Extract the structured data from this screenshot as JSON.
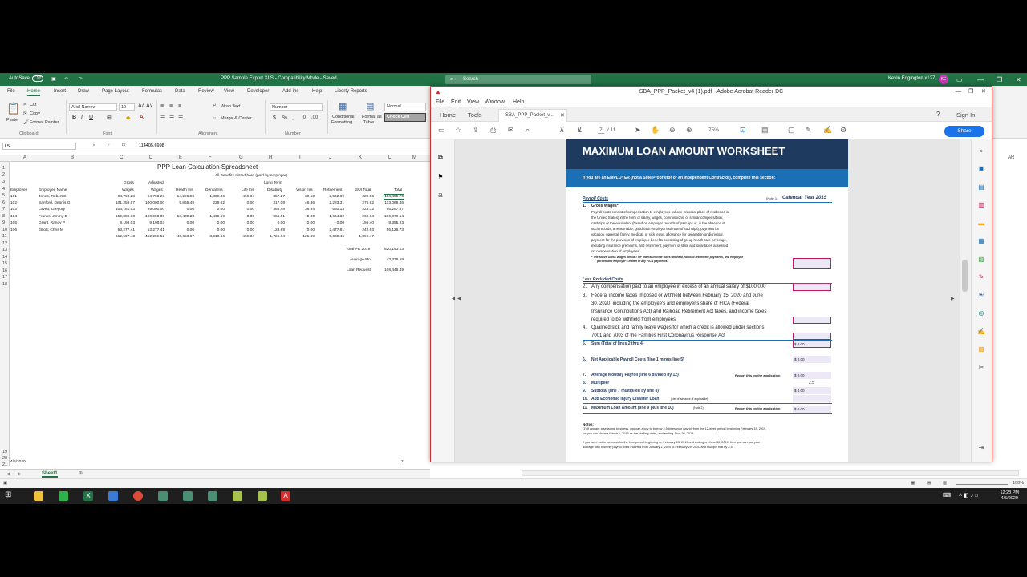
{
  "excel": {
    "autosave": "AutoSave",
    "autosave_state": "Off",
    "title": "PPP Sample Export.XLS  -  Compatibility Mode  -  Saved",
    "search_placeholder": "Search",
    "user": "Kevin Edgington x127",
    "avatar": "KE",
    "tabs": [
      "File",
      "Home",
      "Insert",
      "Draw",
      "Page Layout",
      "Formulas",
      "Data",
      "Review",
      "View",
      "Developer",
      "Add-ins",
      "Help",
      "Liberty Reports"
    ],
    "ribbon": {
      "paste": "Paste",
      "cut": "Cut",
      "copy": "Copy",
      "format_painter": "Format Painter",
      "clipboard": "Clipboard",
      "font_name": "Arial Narrow",
      "font_size": "10",
      "font": "Font",
      "wrap_text": "Wrap Text",
      "merge_center": "Merge & Center",
      "alignment": "Alignment",
      "number_format": "Number",
      "number": "Number",
      "conditional": "Conditional",
      "formatting": "Formatting",
      "format_as": "Format as",
      "table": "Table",
      "style_normal": "Normal",
      "style_check": "Check Cell"
    },
    "name_box": "L5",
    "formula": "114405.6998",
    "columns": [
      "A",
      "B",
      "C",
      "D",
      "E",
      "F",
      "G",
      "H",
      "I",
      "J",
      "K",
      "L",
      "M"
    ],
    "rows": [
      "1",
      "2",
      "3",
      "4",
      "5",
      "6",
      "7",
      "8",
      "9",
      "10",
      "11",
      "12",
      "13",
      "14",
      "15",
      "16",
      "17",
      "18",
      "19",
      "20",
      "21"
    ],
    "sheet": {
      "title": "PPP Loan Calculation Spreadsheet",
      "subtitle": "All Benefits Listed here (paid by employer)",
      "hdr_top": {
        "gross": "Gross",
        "adjusted": "Adjusted",
        "long_term": "Long Term"
      },
      "headers": [
        "Employee",
        "Employee Name",
        "Wages",
        "Wages",
        "Health Ins",
        "Dental Ins",
        "Life Ins",
        "Disability",
        "Vision Ins",
        "Retirement",
        "SUI Total",
        "Total"
      ],
      "data": [
        [
          "101",
          "Jones, Robert E",
          "94,793.28",
          "94,793.28",
          "14,295.90",
          "1,309.36",
          "469.34",
          "357.27",
          "38.10",
          "2,562.89",
          "229.66",
          "114,405.70"
        ],
        [
          "102",
          "Sanford, Dennis G",
          "101,259.67",
          "100,000.00",
          "9,865.49",
          "239.62",
          "0.00",
          "317.09",
          "46.86",
          "2,283.31",
          "276.62",
          "113,068.46"
        ],
        [
          "103",
          "Lovett, Gregory",
          "103,181.53",
          "95,000.00",
          "0.00",
          "0.00",
          "0.00",
          "365.48",
          "36.94",
          "660.13",
          "225.32",
          "96,287.87"
        ],
        [
          "104",
          "Franks, Jimmy D",
          "150,886.70",
          "100,000.00",
          "18,439.28",
          "1,469.69",
          "0.00",
          "556.51",
          "0.00",
          "1,664.32",
          "268.94",
          "130,379.14"
        ],
        [
          "105",
          "Grant, Randy P",
          "9,198.03",
          "9,198.03",
          "0.00",
          "0.00",
          "0.00",
          "0.00",
          "0.00",
          "0.00",
          "156.40",
          "9,355.23"
        ],
        [
          "106",
          "Elliott, Chris M",
          "53,277.41",
          "53,277.41",
          "0.00",
          "0.00",
          "0.00",
          "128.89",
          "0.00",
          "2,477.81",
          "242.63",
          "56,126.73"
        ]
      ],
      "totals": [
        "512,597.43",
        "452,269.52",
        "40,650.67",
        "3,018.66",
        "469.34",
        "1,725.64",
        "121.69",
        "9,638.46",
        "1,399.47"
      ],
      "total_pr_label": "Total PR 2019",
      "total_pr": "520,143.13",
      "avg_label": "Average Mo",
      "avg": "43,378.59",
      "loan_label": "Loan Request",
      "loan": "108,446.49",
      "footer_date": "4/5/2020",
      "footer_page": "2"
    },
    "right_cols": [
      "AR"
    ],
    "sheet_tab": "Sheet1",
    "zoom": "100%"
  },
  "acrobat": {
    "title": "SBA_PPP_Packet_v4 (1).pdf - Adobe Acrobat Reader DC",
    "menu": [
      "File",
      "Edit",
      "View",
      "Window",
      "Help"
    ],
    "tabs": {
      "home": "Home",
      "tools": "Tools",
      "doc": "SBA_PPP_Packet_v..."
    },
    "sign_in": "Sign In",
    "share": "Share",
    "page_current": "7",
    "page_total": "/ 11",
    "zoom": "75%",
    "doc": {
      "heading": "MAXIMUM LOAN AMOUNT WORKSHEET",
      "employer_line": "If you are an EMPLOYER (not a Sole Proprietor or an Independent Contractor), complete this section:",
      "payroll_costs": "Payroll Costs",
      "note1": "(Note 1)",
      "calendar_year": "Calendar Year 2019",
      "item1_title": "Gross Wages*",
      "item1_lines": [
        "Payroll costs consist of compensation to employees (whose principal place of residence is",
        "the United States) in the form of salary, wages, commissions, or similar compensation,",
        "cash tips or the equivalent (based on employer records of past tips or, in the absence of",
        "such records, a reasonable, good-faith employer estimate of such tips), payment for",
        "vacation, parental, family, medical, or sick leave, allowance for separation or dismissal,",
        "payment for the provision of employee benefits consisting of group health care coverage,",
        "including insurance premiums, and retirement, payment of state and local taxes assessed",
        "on compensation of employees."
      ],
      "footnote_star": "* The above Gross Wages are NET OF federal income taxes withheld, railroad retirement payments, and employee",
      "footnote_star2": "portion and employer's match of any FICA payments.",
      "less_excluded": "Less Excluded Costs",
      "item2": "Any compensation paid to an employee in excess of an annual salary of $100,000",
      "item3_lines": [
        "Federal income taxes imposed or withheld between February 15, 2020 and June",
        "30, 2020, including the employee's and employer's share of FICA (Federal",
        "Insurance Contributions Act) and Railroad Retirement Act taxes, and income taxes",
        "required to be withheld from employees"
      ],
      "item4_lines": [
        "Qualified sick and family leave wages for which a credit is allowed under sections",
        "7001 and 7003 of the Families First Coronavirus Response Act"
      ],
      "item5": "Sum (Total of lines 2 thru 4)",
      "item6": "Net Applicable Payroll Costs (line 1 minus line 5)",
      "item7": "Average Monthly Payroll (line 6 divided by 12)",
      "item8": "Multiplier",
      "item9": "Subtotal (line 7 multiplied by line 8)",
      "item10": "Add Economic Injury Disaster Loan",
      "item10_note": "(Net of advance, if applicable)",
      "item11": "Maximum Loan Amount (line 9 plus line 10)",
      "note2": "(Note 2)",
      "report_app": "Report this on the application",
      "zero": "$ 0.00",
      "multiplier_val": "2.5",
      "notes_title": "Notes:",
      "notes_lines": [
        "(1) If you are a seasonal business, you can apply to borrow 2.5 times your payroll from the 12-week period beginning February 15, 2019,",
        "(or you can choose March 1, 2019 as the starting date), and ending June 30, 2019.",
        "If you were not in business for the time period beginning on February 15, 2019 and ending on June 30, 2019, then you can use your",
        "average total monthly payroll costs incurred from January 1, 2020 to February 29, 2020 and multiply that by 2.5."
      ],
      "nums": [
        "1.",
        "2.",
        "3.",
        "4.",
        "5.",
        "6.",
        "7.",
        "8.",
        "9.",
        "10.",
        "11."
      ]
    }
  },
  "taskbar": {
    "time": "12:28 PM",
    "date": "4/5/2020"
  },
  "colors": {
    "excel_green": "#217346",
    "acro_red": "#d32f2f",
    "pdf_navy": "#1e3a5f",
    "pdf_blue": "#1a6fb5",
    "field_pink": "#c2185b"
  }
}
